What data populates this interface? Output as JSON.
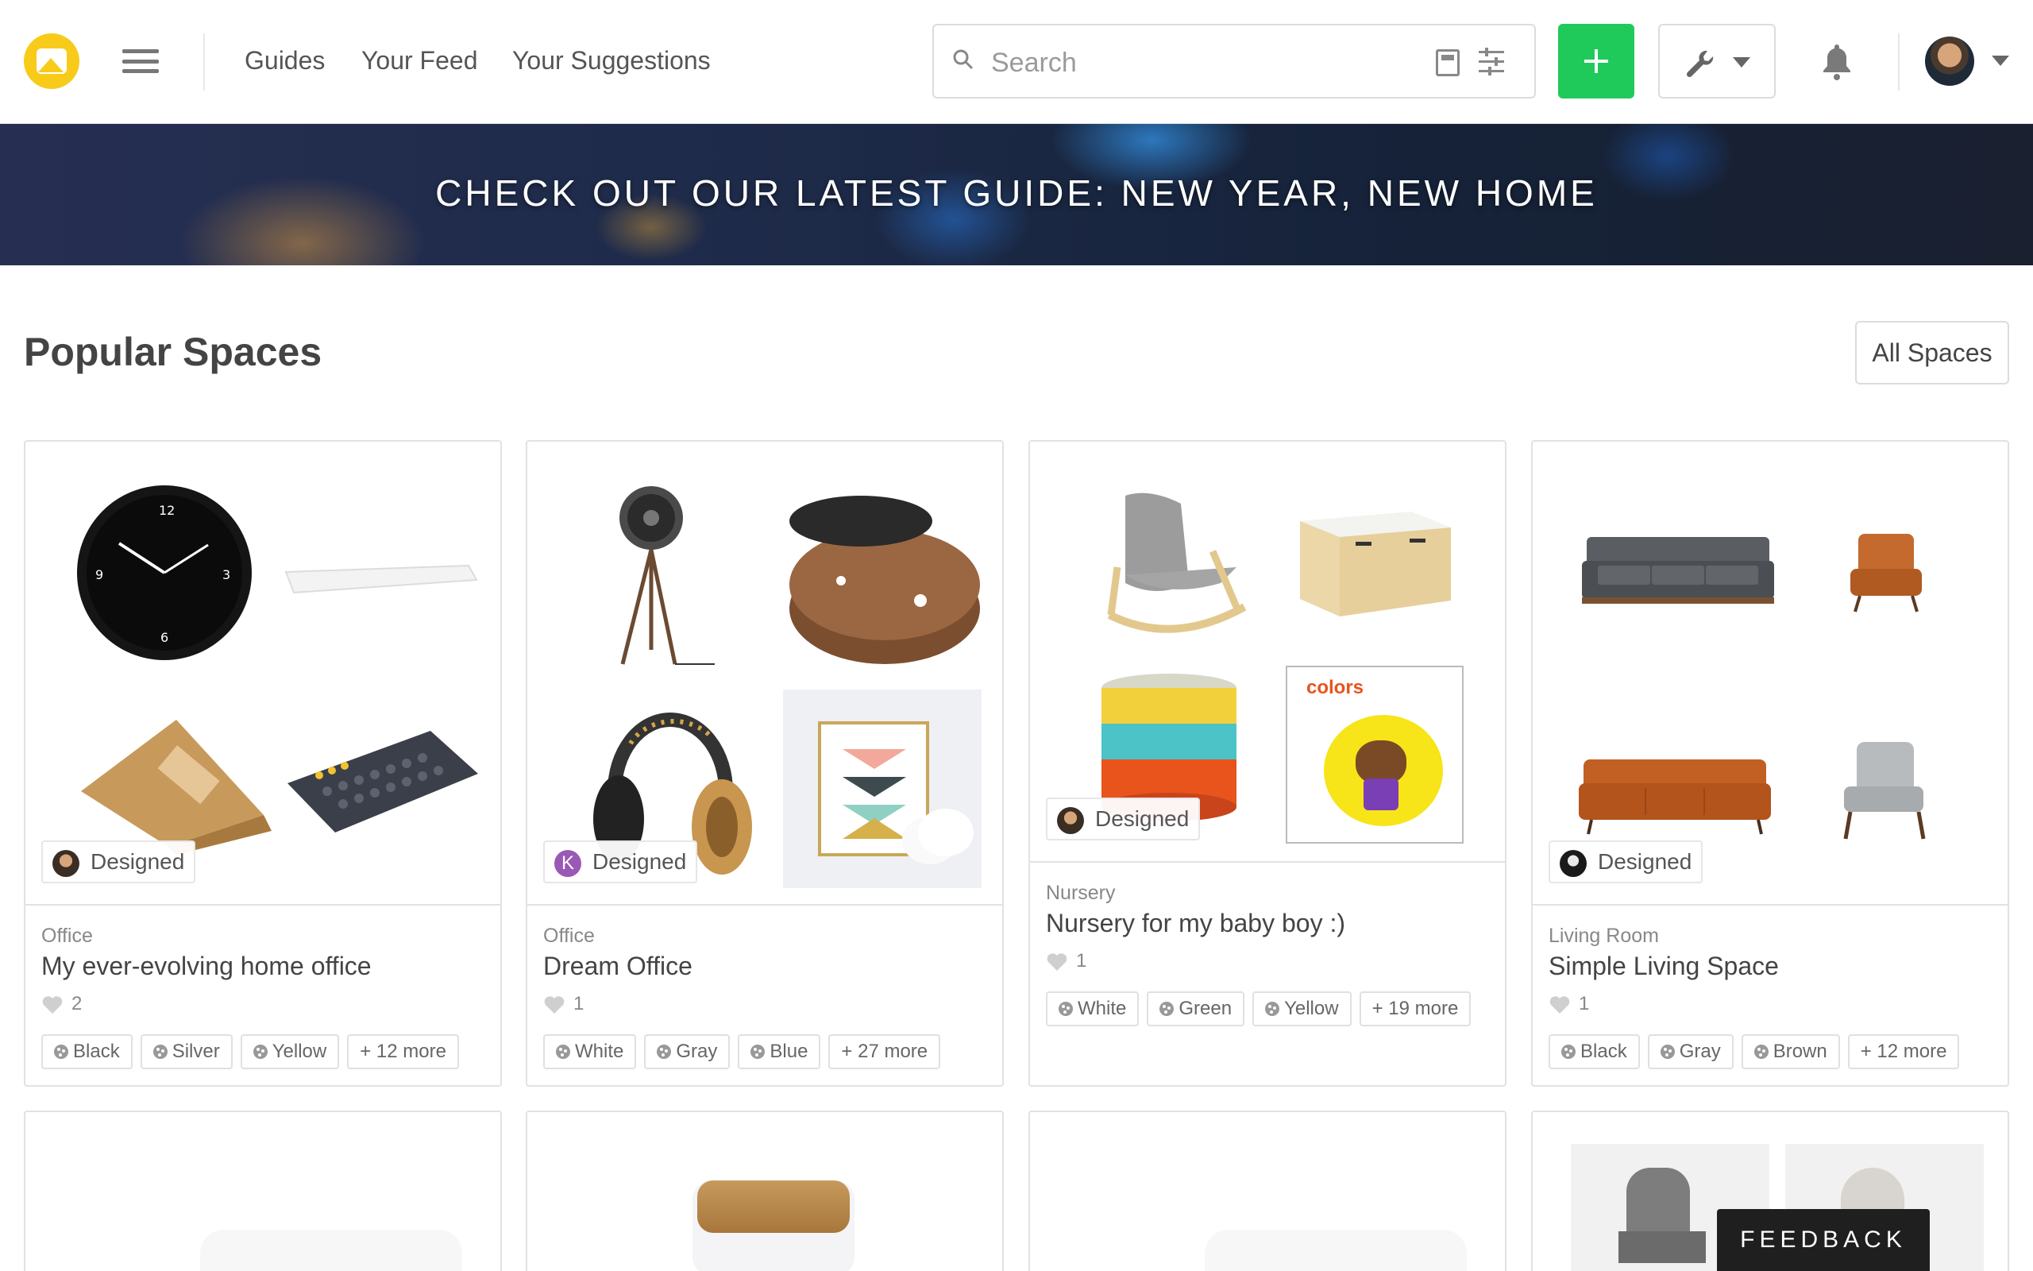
{
  "header": {
    "nav": [
      "Guides",
      "Your Feed",
      "Your Suggestions"
    ],
    "search_placeholder": "Search"
  },
  "banner": {
    "title": "CHECK OUT OUR LATEST GUIDE: NEW YEAR, NEW HOME"
  },
  "section": {
    "title": "Popular Spaces",
    "all_button": "All Spaces"
  },
  "cards": [
    {
      "category": "Office",
      "title": "My ever-evolving home office",
      "likes": "2",
      "badge": "Designed",
      "tags": [
        "Black",
        "Silver",
        "Yellow",
        "+ 12 more"
      ]
    },
    {
      "category": "Office",
      "title": "Dream Office",
      "likes": "1",
      "badge": "Designed",
      "badge_initial": "K",
      "tags": [
        "White",
        "Gray",
        "Blue",
        "+ 27 more"
      ]
    },
    {
      "category": "Nursery",
      "title": "Nursery for my baby boy :)",
      "likes": "1",
      "badge": "Designed",
      "book_title": "colors",
      "tags": [
        "White",
        "Green",
        "Yellow",
        "+ 19 more"
      ]
    },
    {
      "category": "Living Room",
      "title": "Simple Living Space",
      "likes": "1",
      "badge": "Designed",
      "tags": [
        "Black",
        "Gray",
        "Brown",
        "+ 12 more"
      ]
    }
  ],
  "feedback": {
    "label": "FEEDBACK"
  },
  "colors": {
    "accent_green": "#1fca5a",
    "logo_yellow": "#f8cb1a"
  }
}
